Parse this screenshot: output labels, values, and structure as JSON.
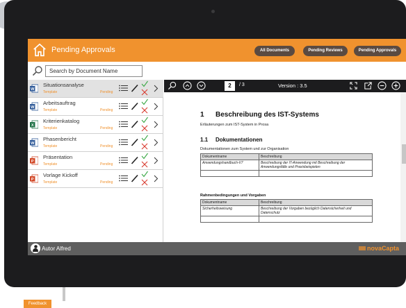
{
  "header": {
    "title": "Pending Approvals",
    "buttons": [
      "All Documents",
      "Pending Reviews",
      "Pending Approvals"
    ]
  },
  "search": {
    "placeholder": "Search by Document Name"
  },
  "documents": [
    {
      "name": "Situationsanalyse",
      "type": "Template",
      "status": "Pending",
      "file_icon": "word-icon",
      "icon_color": "#2b5797",
      "selected": true
    },
    {
      "name": "Arbeitsauftrag",
      "type": "Template",
      "status": "Pending",
      "file_icon": "word-icon",
      "icon_color": "#2b5797",
      "selected": false
    },
    {
      "name": "Kriterienkatalog",
      "type": "Template",
      "status": "Pending",
      "file_icon": "excel-icon",
      "icon_color": "#1e7145",
      "selected": false
    },
    {
      "name": "Phasenbericht",
      "type": "Template",
      "status": "Pending",
      "file_icon": "word-icon",
      "icon_color": "#2b5797",
      "selected": false
    },
    {
      "name": "Präsentation",
      "type": "Template",
      "status": "Pending",
      "file_icon": "powerpoint-icon",
      "icon_color": "#d24726",
      "selected": false
    },
    {
      "name": "Vorlage Kickoff",
      "type": "Template",
      "status": "Pending",
      "file_icon": "powerpoint-icon",
      "icon_color": "#d24726",
      "selected": false
    }
  ],
  "viewer": {
    "page": "2",
    "page_total": "/ 3",
    "version": "Version : 3.5"
  },
  "document": {
    "h1_num": "1",
    "h1": "Beschreibung des IST-Systems",
    "p1": "Erläuterungen zum IST-System in Prosa",
    "h2_num": "1.1",
    "h2": "Dokumentationen",
    "p2": "Dokumentationen zum System und zur Organisation",
    "table1": {
      "headers": [
        "Dokumentname",
        "Beschreibung"
      ],
      "rows": [
        [
          "Anwendungshandbuch-V7",
          "Beschreibung der IT-Anwendung mit Beschreibung der Anwendungsfälle und Praxisbeispielen"
        ]
      ]
    },
    "h3": "Rahmenbedingungen und Vorgaben",
    "table2": {
      "headers": [
        "Dokumentname",
        "Beschreibung"
      ],
      "rows": [
        [
          "Sicherheitsweisung",
          "Beschreibung der Vorgaben bezüglich Datensicherheit und Datenschutz"
        ]
      ]
    }
  },
  "footer": {
    "author": "Autor Alfred",
    "brand": "novaCapta"
  },
  "feedback": "Feedback",
  "colors": {
    "accent": "#f0922e",
    "header_button": "#5a4a41",
    "approve": "#3aa845",
    "reject": "#d83b2f"
  }
}
